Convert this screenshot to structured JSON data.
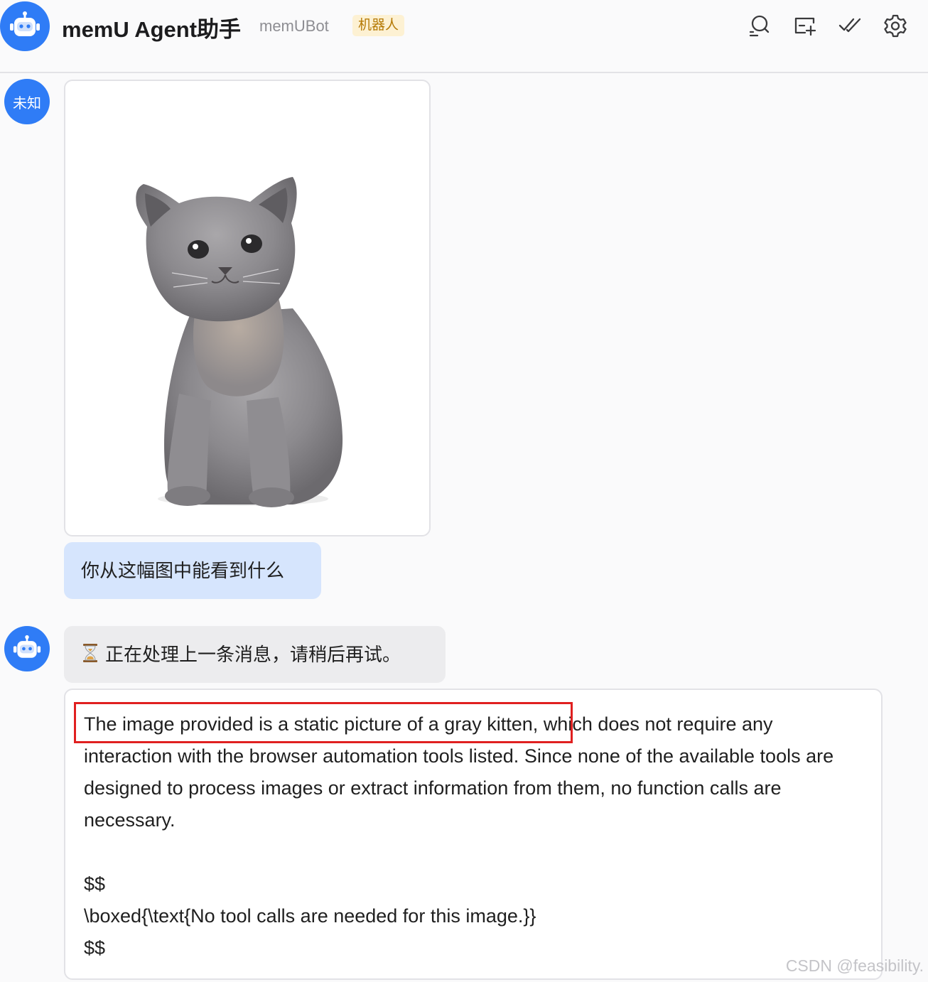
{
  "header": {
    "title": "memU Agent助手",
    "subtitle": "memUBot",
    "tag": "机器人"
  },
  "messages": {
    "user_avatar_label": "未知",
    "user_question": "你从这幅图中能看到什么",
    "status_text": "正在处理上一条消息，请稍后再试。",
    "reply_lines": [
      "The image provided is a static picture of a gray kitten, which does not require any interaction with the browser automation tools listed. Since none of the available tools are designed to process images or extract information from them, no function calls are necessary.",
      "$$",
      "\\boxed{\\text{No tool calls are needed for this image.}}",
      "$$"
    ]
  },
  "watermark": "CSDN @feasibility.",
  "colors": {
    "accent": "#2f7cf6",
    "user_bubble": "#d6e5fd",
    "status_bubble": "#ececee",
    "tag_bg": "#fdf1d3",
    "tag_text": "#b57a06",
    "highlight": "#e02020"
  }
}
